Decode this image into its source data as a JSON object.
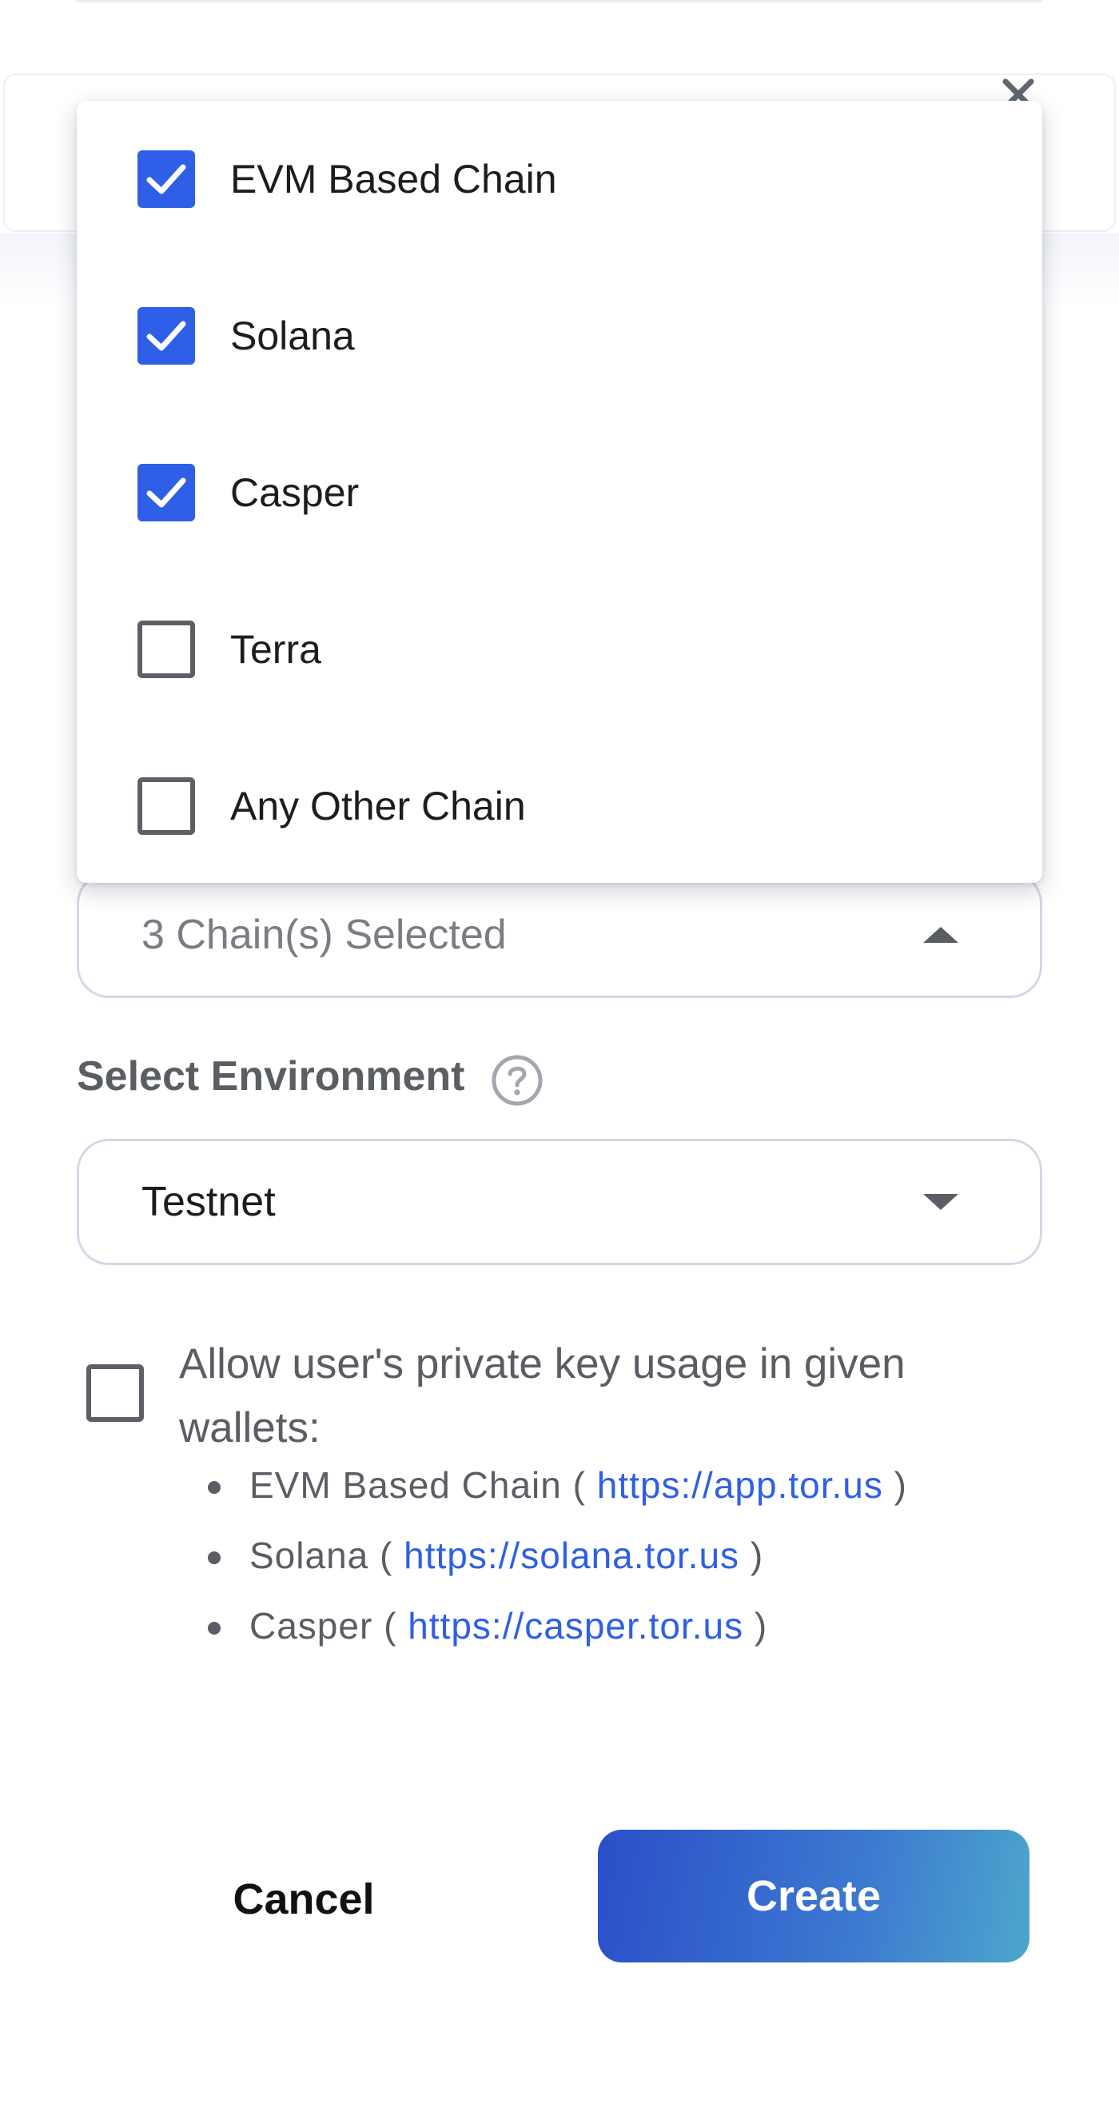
{
  "chain_menu": {
    "items": [
      {
        "label": "EVM Based Chain",
        "checked": true
      },
      {
        "label": "Solana",
        "checked": true
      },
      {
        "label": "Casper",
        "checked": true
      },
      {
        "label": "Terra",
        "checked": false
      },
      {
        "label": "Any Other Chain",
        "checked": false
      }
    ]
  },
  "chains_select": {
    "value": "3 Chain(s) Selected",
    "expanded": true,
    "caret_icon": "caret-up-icon"
  },
  "environment": {
    "label": "Select Environment",
    "help_icon": "help-circle-icon",
    "value": "Testnet",
    "caret_icon": "caret-down-icon"
  },
  "private_key": {
    "checked": false,
    "text": "Allow user's private key usage in given wallets:",
    "wallets": [
      {
        "name": "EVM Based Chain",
        "url": "https://app.tor.us"
      },
      {
        "name": "Solana",
        "url": "https://solana.tor.us"
      },
      {
        "name": "Casper",
        "url": "https://casper.tor.us"
      }
    ]
  },
  "actions": {
    "cancel_label": "Cancel",
    "create_label": "Create"
  },
  "colors": {
    "accent": "#2e5fe6",
    "create_gradient_start": "#2a4fc8",
    "create_gradient_end": "#4da6cc",
    "text_muted": "#5a5d64",
    "border": "#d5d7e6"
  }
}
